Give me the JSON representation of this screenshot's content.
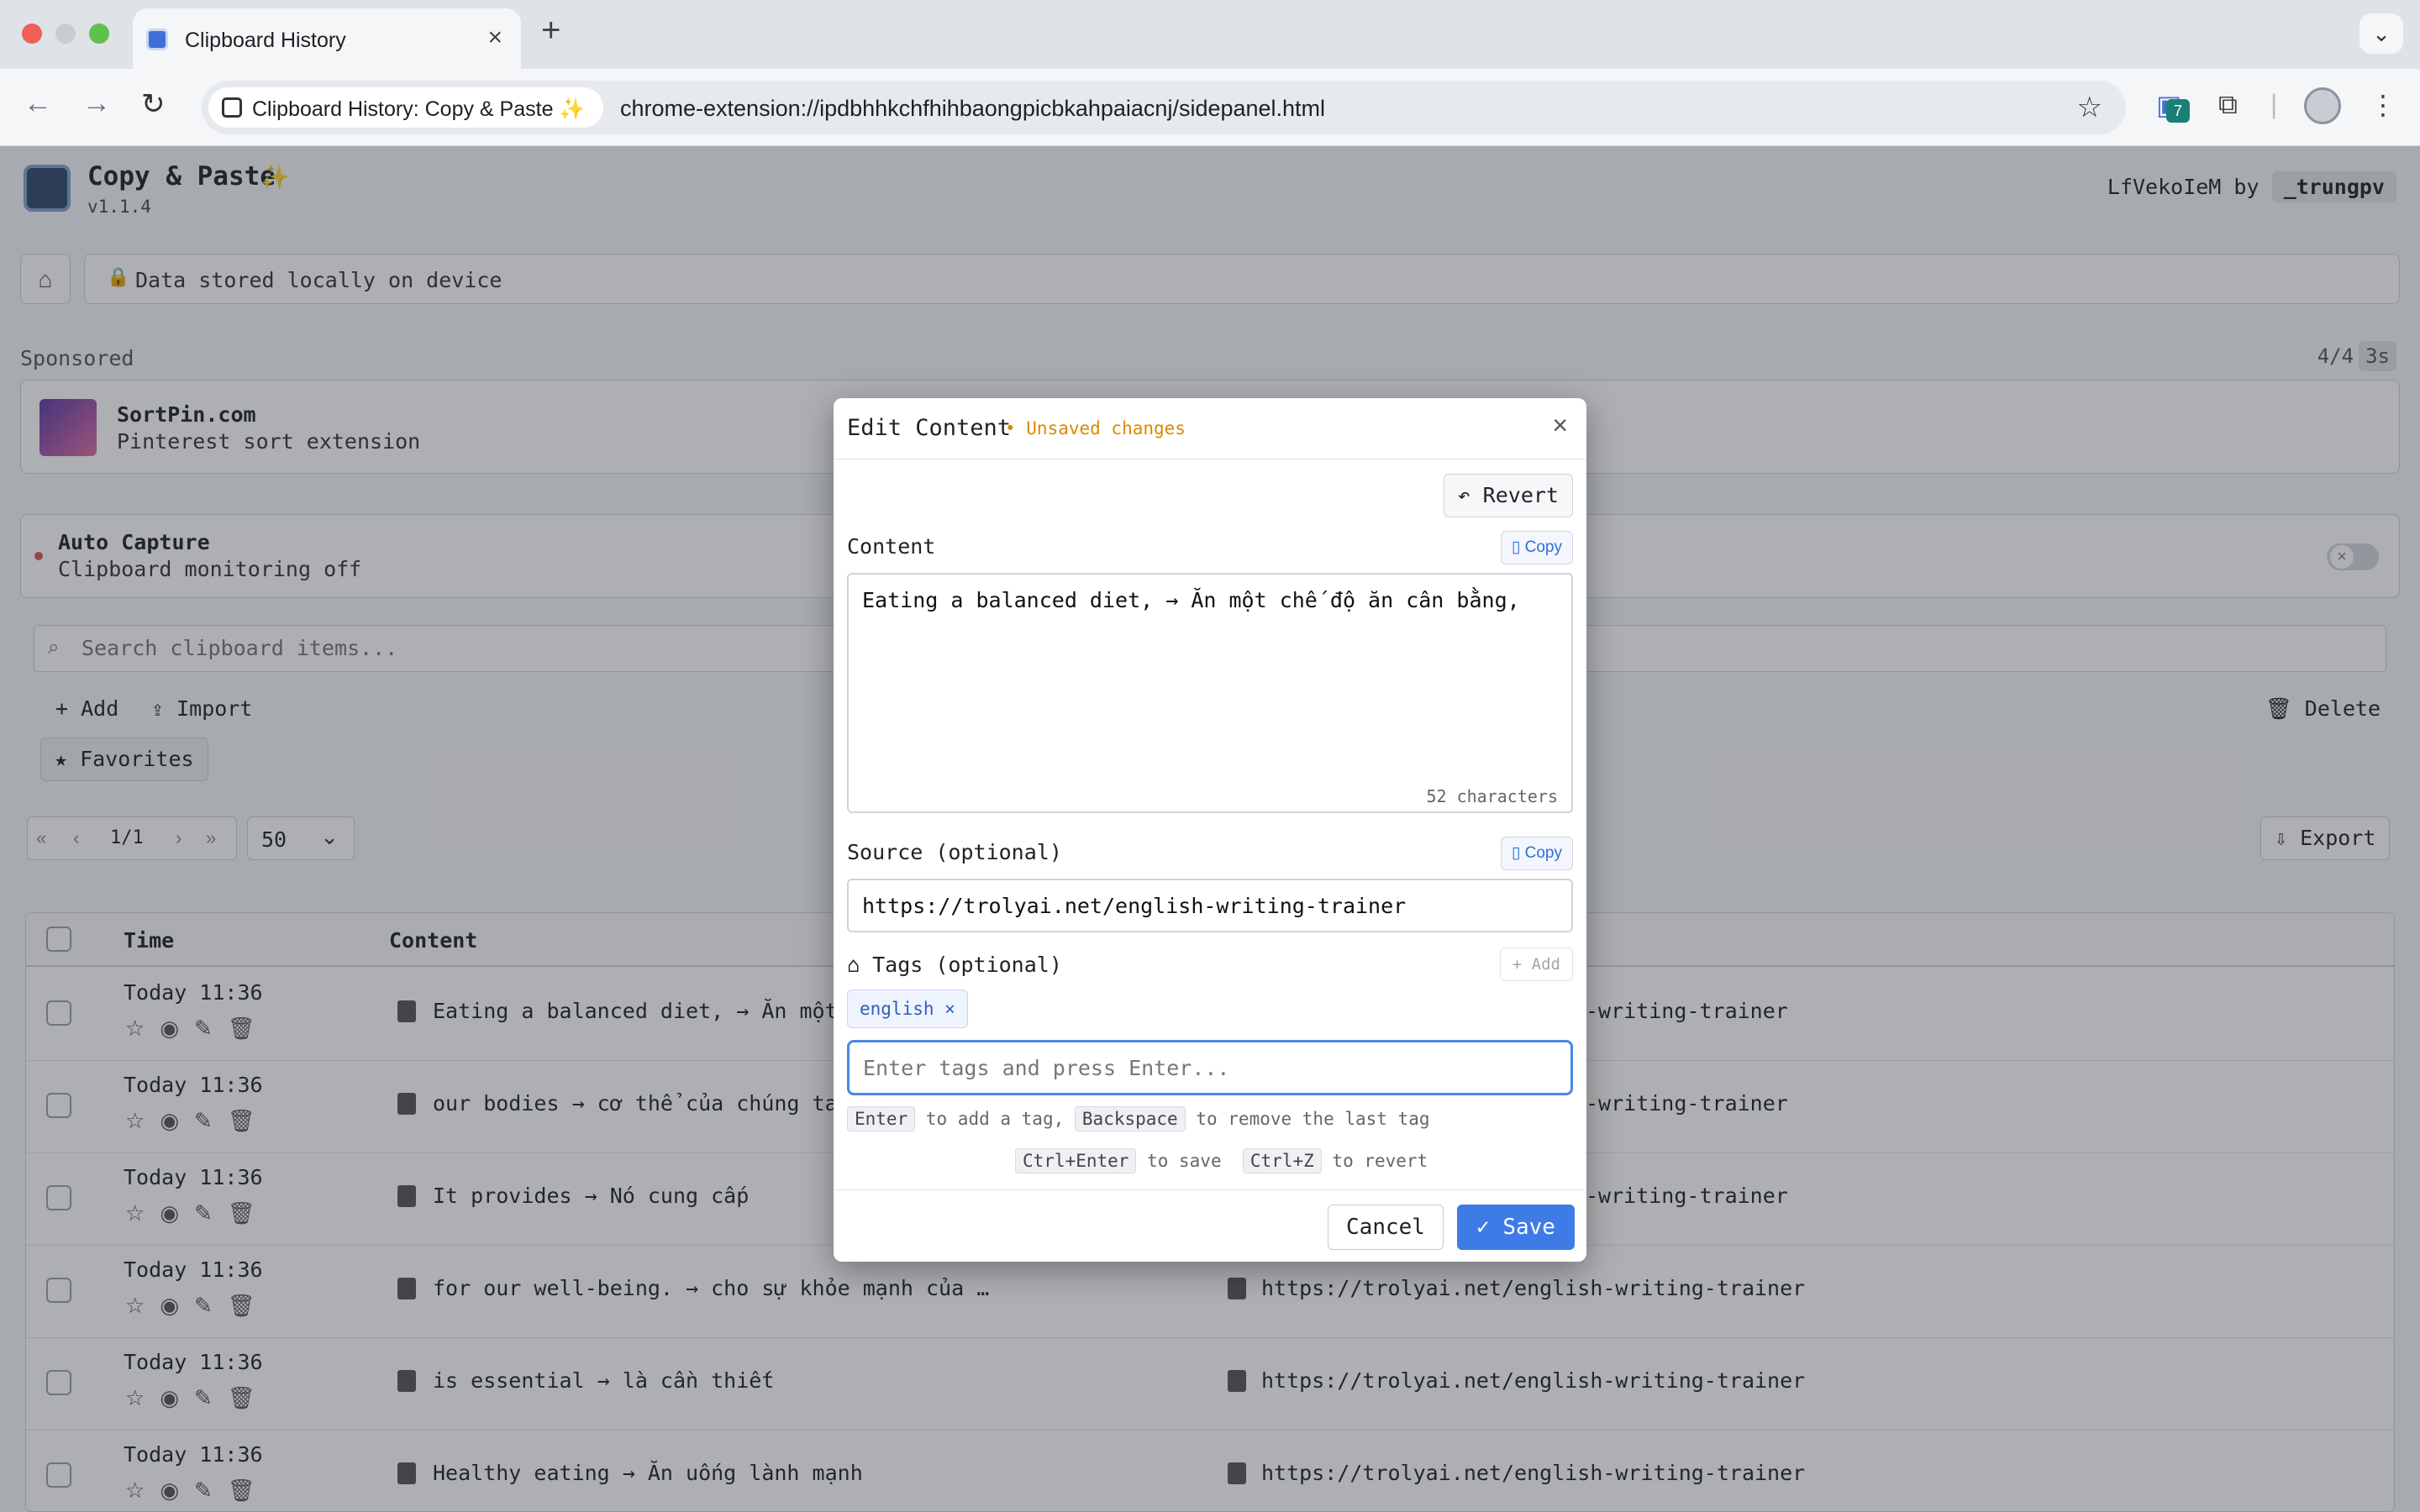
{
  "browser": {
    "tab_title": "Clipboard History",
    "site_chip": "Clipboard History: Copy & Paste ✨",
    "url": "chrome-extension://ipdbhhkchfhihbaongpicbkahpaiacnj/sidepanel.html",
    "ext_badge": "7"
  },
  "app": {
    "name": "Copy & Paste",
    "sparkle": "✨",
    "version": "v1.1.4",
    "user_prefix": "LfVekoIeM by",
    "user_name": "_trungpv",
    "storage_text": "Data stored locally on device"
  },
  "sponsored": {
    "label": "Sponsored",
    "counter": "4/4",
    "seconds": "3s",
    "title": "SortPin.com",
    "description": "Pinterest sort extension"
  },
  "capture": {
    "title": "Auto Capture",
    "status": "Clipboard monitoring off"
  },
  "search": {
    "placeholder": "Search clipboard items..."
  },
  "actions": {
    "add": "+ Add",
    "import": "⇪ Import",
    "favorites": "★ Favorites",
    "delete": "🗑 Delete",
    "export": "⇩ Export"
  },
  "pager": {
    "page": "1/1",
    "per_page": "50"
  },
  "table": {
    "headers": {
      "time": "Time",
      "content": "Content"
    },
    "rows": [
      {
        "time": "Today 11:36",
        "content": "Eating a balanced diet, → Ăn một",
        "source": "-writing-trainer"
      },
      {
        "time": "Today 11:36",
        "content": "our bodies → cơ thể của chúng ta",
        "source": "-writing-trainer"
      },
      {
        "time": "Today 11:36",
        "content": "It provides → Nó cung cấp",
        "source": "-writing-trainer"
      },
      {
        "time": "Today 11:36",
        "content": "for our well-being. → cho sự khỏe mạnh của …",
        "source": "https://trolyai.net/english-writing-trainer"
      },
      {
        "time": "Today 11:36",
        "content": "is essential → là cần thiết",
        "source": "https://trolyai.net/english-writing-trainer"
      },
      {
        "time": "Today 11:36",
        "content": "Healthy eating → Ăn uống lành mạnh",
        "source": "https://trolyai.net/english-writing-trainer"
      }
    ]
  },
  "modal": {
    "title": "Edit Content",
    "unsaved": "• Unsaved changes",
    "revert": "↶ Revert",
    "content_label": "Content",
    "copy_label": "Copy",
    "content_value": "Eating a balanced diet, → Ăn một chế độ ăn cân bằng,",
    "char_count": "52 characters",
    "source_label": "Source (optional)",
    "source_value": "https://trolyai.net/english-writing-trainer",
    "tags_label": "Tags (optional)",
    "tags_add": "+ Add",
    "tag": "english",
    "tag_placeholder": "Enter tags and press Enter...",
    "hint_enter_key": "Enter",
    "hint_enter_text": "to add a tag,",
    "hint_backspace_key": "Backspace",
    "hint_backspace_text": "to remove the last tag",
    "hint_save_key": "Ctrl+Enter",
    "hint_save_text": "to save",
    "hint_revert_key": "Ctrl+Z",
    "hint_revert_text": "to revert",
    "cancel": "Cancel",
    "save": "✓ Save"
  }
}
